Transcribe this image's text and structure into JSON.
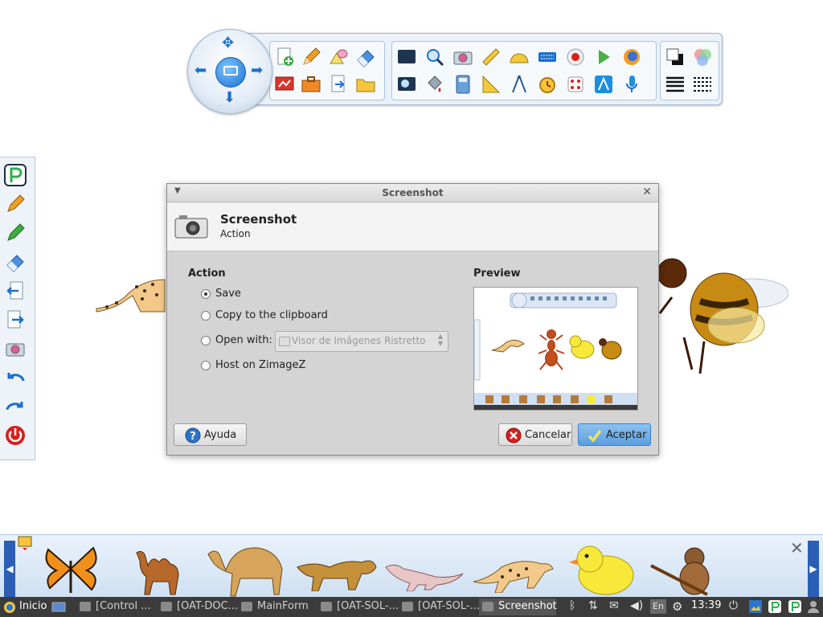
{
  "dialog": {
    "window_title": "Screenshot",
    "header_title": "Screenshot",
    "header_subtitle": "Action",
    "action_section_title": "Action",
    "preview_section_title": "Preview",
    "options": [
      {
        "label": "Save",
        "selected": true
      },
      {
        "label": "Copy to the clipboard",
        "selected": false
      },
      {
        "label": "Open with:",
        "selected": false
      },
      {
        "label": "Host on ZimageZ",
        "selected": false
      }
    ],
    "open_with_value": "Visor de Imágenes Ristretto",
    "buttons": {
      "help": "Ayuda",
      "cancel": "Cancelar",
      "accept": "Aceptar"
    }
  },
  "taskbar": {
    "start_label": "Inicio",
    "tasks": [
      {
        "label": "[Control ...",
        "active": false
      },
      {
        "label": "[OAT-DOC...",
        "active": false
      },
      {
        "label": "MainForm",
        "active": false
      },
      {
        "label": "[OAT-SOL-...",
        "active": false
      },
      {
        "label": "[OAT-SOL-...",
        "active": false
      },
      {
        "label": "Screenshot",
        "active": true
      }
    ],
    "keyboard_layout": "En",
    "clock": "13:39"
  },
  "colors": {
    "accent": "#1b6fd0",
    "dialog_bg": "#d4d4d4",
    "taskbar_bg": "#3b3b3b",
    "dock_arrow": "#2a5fb5"
  }
}
